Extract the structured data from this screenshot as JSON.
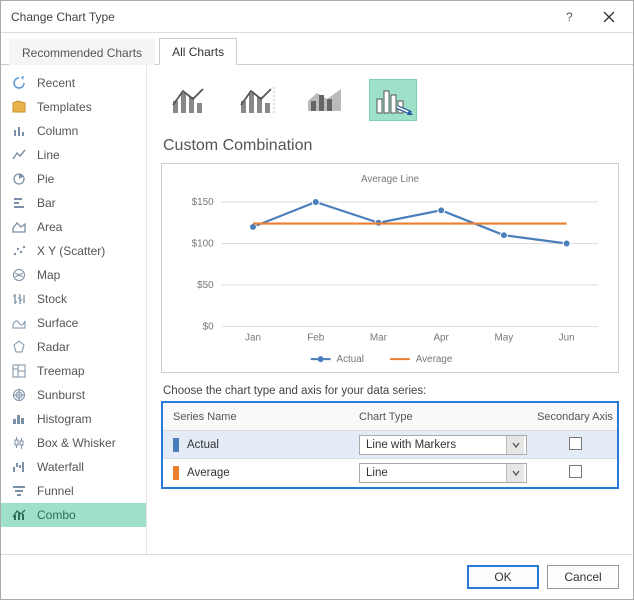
{
  "title": "Change Chart Type",
  "tabs": {
    "recommended": "Recommended Charts",
    "all": "All Charts"
  },
  "sidebar": {
    "items": [
      {
        "id": "recent",
        "label": "Recent"
      },
      {
        "id": "templates",
        "label": "Templates"
      },
      {
        "id": "column",
        "label": "Column"
      },
      {
        "id": "line",
        "label": "Line"
      },
      {
        "id": "pie",
        "label": "Pie"
      },
      {
        "id": "bar",
        "label": "Bar"
      },
      {
        "id": "area",
        "label": "Area"
      },
      {
        "id": "xyscatter",
        "label": "X Y (Scatter)"
      },
      {
        "id": "map",
        "label": "Map"
      },
      {
        "id": "stock",
        "label": "Stock"
      },
      {
        "id": "surface",
        "label": "Surface"
      },
      {
        "id": "radar",
        "label": "Radar"
      },
      {
        "id": "treemap",
        "label": "Treemap"
      },
      {
        "id": "sunburst",
        "label": "Sunburst"
      },
      {
        "id": "histogram",
        "label": "Histogram"
      },
      {
        "id": "boxwhisker",
        "label": "Box & Whisker"
      },
      {
        "id": "waterfall",
        "label": "Waterfall"
      },
      {
        "id": "funnel",
        "label": "Funnel"
      },
      {
        "id": "combo",
        "label": "Combo"
      }
    ]
  },
  "section_title": "Custom Combination",
  "series_instruction": "Choose the chart type and axis for your data series:",
  "table": {
    "headers": {
      "name": "Series Name",
      "chart": "Chart Type",
      "axis": "Secondary Axis"
    },
    "rows": [
      {
        "swatch": "#4a7ebb",
        "name": "Actual",
        "chart": "Line with Markers",
        "secondary": false
      },
      {
        "swatch": "#ed7d31",
        "name": "Average",
        "chart": "Line",
        "secondary": false
      }
    ]
  },
  "buttons": {
    "ok": "OK",
    "cancel": "Cancel"
  },
  "chart_data": {
    "type": "line",
    "title": "Average Line",
    "categories": [
      "Jan",
      "Feb",
      "Mar",
      "Apr",
      "May",
      "Jun"
    ],
    "series": [
      {
        "name": "Actual",
        "values": [
          120,
          150,
          125,
          140,
          110,
          100
        ],
        "color": "#4a7ebb",
        "markers": true
      },
      {
        "name": "Average",
        "values": [
          124,
          124,
          124,
          124,
          124,
          124
        ],
        "color": "#ed7d31",
        "markers": false
      }
    ],
    "ylabel": "",
    "ylim": [
      0,
      160
    ],
    "yticks": [
      "$0",
      "$50",
      "$100",
      "$150"
    ],
    "legend": [
      "Actual",
      "Average"
    ]
  }
}
